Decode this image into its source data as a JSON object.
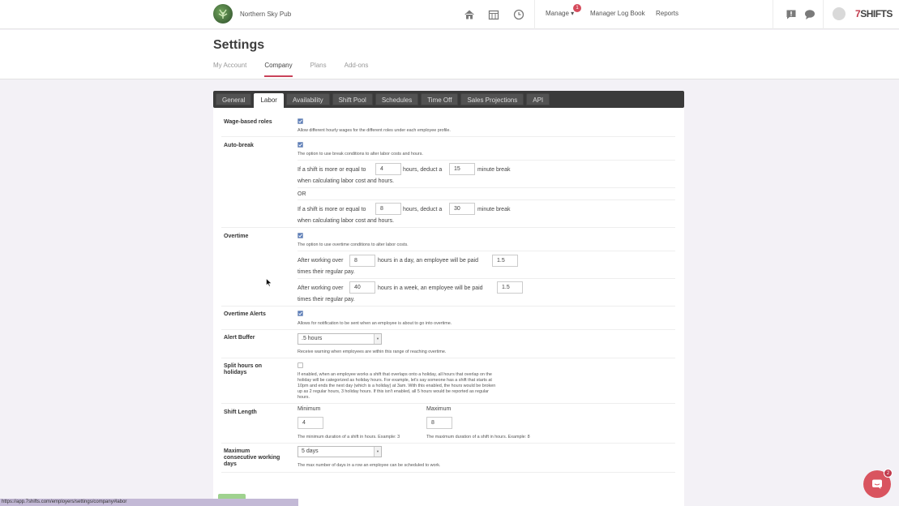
{
  "topbar": {
    "company": "Northern Sky Pub",
    "nav": [
      "Manage",
      "Manager Log Book",
      "Reports"
    ],
    "manage_badge": "1",
    "brand": "7SHIFTS"
  },
  "header": {
    "title": "Settings",
    "subtabs": [
      "My Account",
      "Company",
      "Plans",
      "Add-ons"
    ]
  },
  "tabs": [
    "General",
    "Labor",
    "Availability",
    "Shift Pool",
    "Schedules",
    "Time Off",
    "Sales Projections",
    "API"
  ],
  "labor": {
    "wage_roles": {
      "label": "Wage-based roles",
      "checked": true,
      "desc": "Allow different hourly wages for the different roles under each employee profile."
    },
    "auto_break": {
      "label": "Auto-break",
      "checked": true,
      "desc": "The option to use break conditions to alter labor costs and hours.",
      "pre": "If a shift is more or equal to",
      "mid": "hours, deduct a",
      "post": "minute break",
      "tail": "when calculating labor cost and hours.",
      "or": "OR",
      "rule1": {
        "hours": "4",
        "minutes": "15"
      },
      "rule2": {
        "hours": "8",
        "minutes": "30"
      }
    },
    "overtime": {
      "label": "Overtime",
      "checked": true,
      "desc": "The option to use overtime conditions to alter labor costs.",
      "pre": "After working over",
      "day_mid": "hours in a day, an employee will be paid",
      "week_mid": "hours in a week, an employee will be paid",
      "tail": "times their regular pay.",
      "day_hours": "8",
      "day_rate": "1.5",
      "week_hours": "40",
      "week_rate": "1.5"
    },
    "overtime_alerts": {
      "label": "Overtime Alerts",
      "checked": true,
      "desc": "Allows for notification to be sent when an employee is about to go into overtime."
    },
    "alert_buffer": {
      "label": "Alert Buffer",
      "value": ".5 hours",
      "desc": "Receive warning when employees are within this range of reaching overtime."
    },
    "split_hours": {
      "label1": "Split hours on",
      "label2": "holidays",
      "checked": false,
      "desc_lines": [
        "If enabled, when an employee works a shift that overlaps onto a holiday, all hours that overlap on the",
        "holiday will be categorized as holiday hours. For example, let's say someone has a shift that starts at",
        "10pm and ends the next day (which is a holiday) at 3am. With this enabled, the hours would be broken",
        "up as 2 regular hours, 3 holiday hours. If this isn't enabled, all 5 hours would be reported as regular",
        "hours."
      ]
    },
    "shift_length": {
      "label": "Shift Length",
      "min_label": "Minimum",
      "max_label": "Maximum",
      "min_value": "4",
      "max_value": "8",
      "min_desc": "The minimum duration of a shift in hours. Example: 3",
      "max_desc": "The maximum duration of a shift in hours. Example: 8"
    },
    "max_days": {
      "label1": "Maximum",
      "label2": "consecutive working",
      "label3": "days",
      "value": "5 days",
      "desc": "The max number of days in a row an employee can be scheduled to work."
    }
  },
  "status_url": "https://app.7shifts.com/employers/settings/company#labor",
  "chat_badge": "2"
}
